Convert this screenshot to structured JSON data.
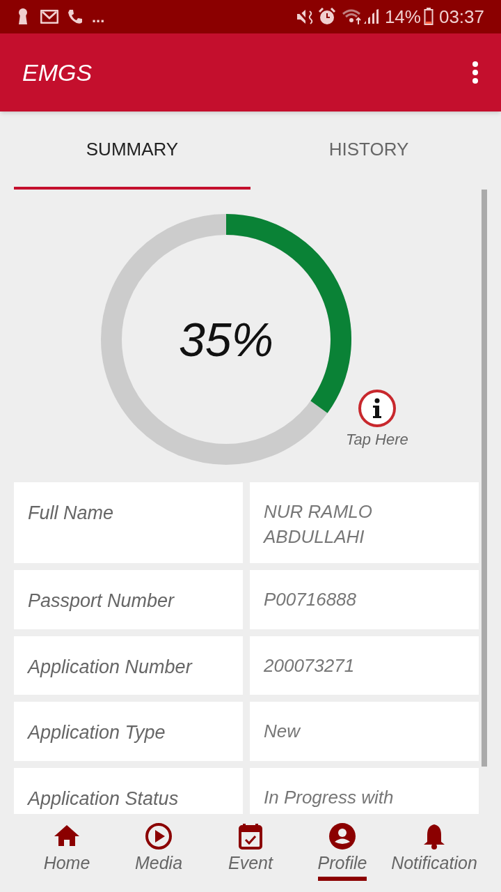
{
  "status_bar": {
    "overflow": "...",
    "battery": "14%",
    "time": "03:37"
  },
  "app_bar": {
    "title": "EMGS"
  },
  "tabs": [
    {
      "label": "SUMMARY",
      "selected": true
    },
    {
      "label": "HISTORY",
      "selected": false
    }
  ],
  "progress": {
    "reading": "35%",
    "info_label": "Tap Here"
  },
  "details": [
    {
      "label": "Full Name",
      "value": "NUR RAMLO ABDULLAHI"
    },
    {
      "label": "Passport Number",
      "value": "P00716888"
    },
    {
      "label": "Application Number",
      "value": "200073271"
    },
    {
      "label": "Application Type",
      "value": "New"
    },
    {
      "label": "Application Status",
      "value": "In Progress with"
    }
  ],
  "bottom_nav": [
    {
      "label": "Home",
      "kind": "home",
      "selected": false
    },
    {
      "label": "Media",
      "kind": "media",
      "selected": false
    },
    {
      "label": "Event",
      "kind": "event",
      "selected": false
    },
    {
      "label": "Profile",
      "kind": "profile",
      "selected": true
    },
    {
      "label": "Notification",
      "kind": "bell",
      "selected": false
    }
  ]
}
